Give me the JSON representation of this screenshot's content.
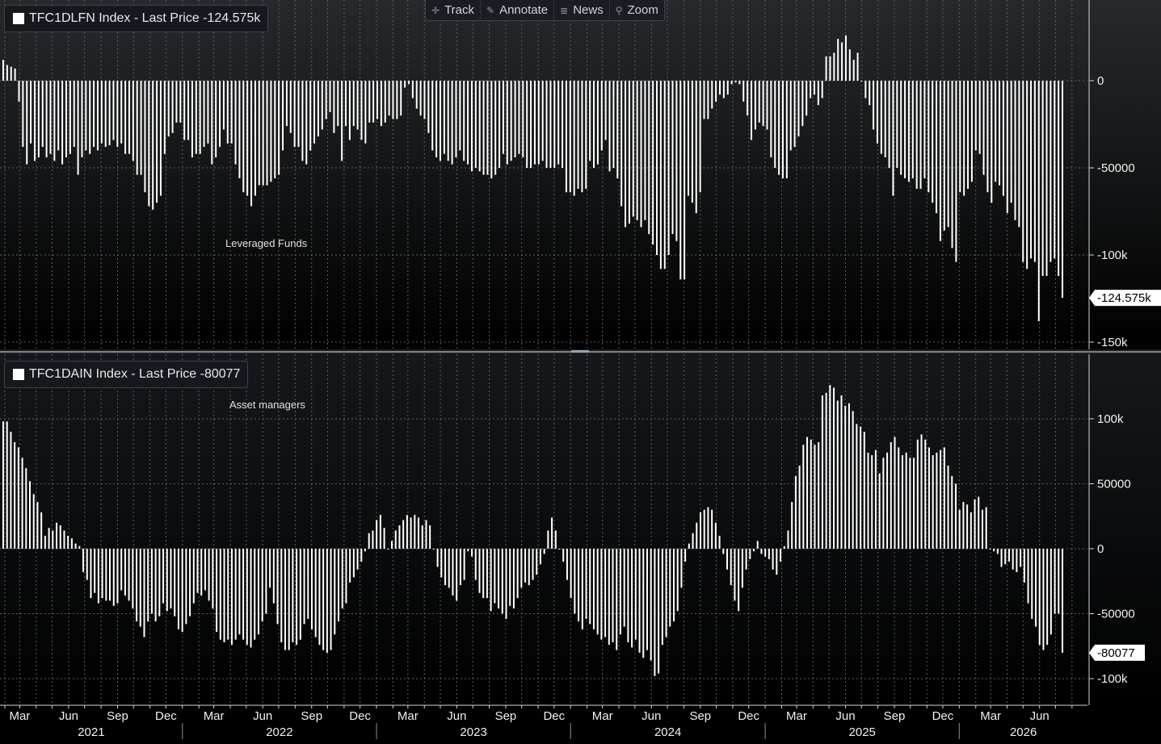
{
  "toolbar": {
    "track": "Track",
    "annotate": "Annotate",
    "news": "News",
    "zoom": "Zoom"
  },
  "panels": {
    "top": {
      "legend": "TFC1DLFN Index - Last Price -124.575k",
      "label": "Leveraged Funds"
    },
    "bottom": {
      "legend": "TFC1DAIN Index - Last Price -80077",
      "label": "Asset managers"
    }
  },
  "colors": {
    "background_top": "#202326",
    "background_bottom": "#000000",
    "bars": "#ffffff",
    "grid": "#5a5f66"
  },
  "chart_data": [
    {
      "type": "bar",
      "title": "",
      "series_label": "Leveraged Funds",
      "last_price_label": "-124.575k",
      "last_price": -124575,
      "ylim": [
        -150000,
        30000
      ],
      "y_ticks": [
        0,
        -50000,
        -100000,
        -150000
      ],
      "y_tick_labels": [
        "0",
        "-50000",
        "-100k",
        "-150k"
      ],
      "grid": true,
      "x_start": "2021-01-29",
      "x_end": "2026-07-14",
      "values": [
        12000,
        9000,
        8000,
        7000,
        -12000,
        -38000,
        -48000,
        -36000,
        -46000,
        -44000,
        -38000,
        -44000,
        -42000,
        -46000,
        -40000,
        -48000,
        -44000,
        -42000,
        -38000,
        -54000,
        -44000,
        -40000,
        -42000,
        -38000,
        -40000,
        -36000,
        -38000,
        -37000,
        -34000,
        -38000,
        -36000,
        -42000,
        -42000,
        -46000,
        -54000,
        -54000,
        -64000,
        -72000,
        -74000,
        -70000,
        -66000,
        -42000,
        -32000,
        -30000,
        -24000,
        -24000,
        -34000,
        -34000,
        -44000,
        -42000,
        -42000,
        -38000,
        -36000,
        -48000,
        -44000,
        -38000,
        -28000,
        -36000,
        -36000,
        -48000,
        -56000,
        -64000,
        -66000,
        -72000,
        -66000,
        -60000,
        -60000,
        -60000,
        -58000,
        -56000,
        -54000,
        -40000,
        -26000,
        -30000,
        -38000,
        -38000,
        -46000,
        -48000,
        -40000,
        -36000,
        -32000,
        -28000,
        -22000,
        -18000,
        -30000,
        -26000,
        -46000,
        -26000,
        -34000,
        -26000,
        -28000,
        -34000,
        -36000,
        -24000,
        -24000,
        -22000,
        -26000,
        -24000,
        -20000,
        -22000,
        -22000,
        -20000,
        -4000,
        -2000,
        -10000,
        -16000,
        -20000,
        -22000,
        -30000,
        -40000,
        -44000,
        -46000,
        -42000,
        -46000,
        -48000,
        -44000,
        -40000,
        -46000,
        -48000,
        -52000,
        -50000,
        -52000,
        -54000,
        -54000,
        -56000,
        -54000,
        -50000,
        -42000,
        -48000,
        -46000,
        -44000,
        -42000,
        -44000,
        -50000,
        -50000,
        -48000,
        -48000,
        -46000,
        -50000,
        -50000,
        -50000,
        -48000,
        -50000,
        -64000,
        -64000,
        -66000,
        -62000,
        -64000,
        -62000,
        -46000,
        -50000,
        -48000,
        -40000,
        -34000,
        -52000,
        -50000,
        -56000,
        -72000,
        -84000,
        -82000,
        -78000,
        -80000,
        -84000,
        -80000,
        -88000,
        -94000,
        -100000,
        -108000,
        -108000,
        -100000,
        -88000,
        -92000,
        -114000,
        -114000,
        -66000,
        -70000,
        -76000,
        -64000,
        -22000,
        -22000,
        -16000,
        -12000,
        -8000,
        -10000,
        -8000,
        -2000,
        -1000,
        -2000,
        -12000,
        -20000,
        -34000,
        -28000,
        -24000,
        -26000,
        -28000,
        -44000,
        -50000,
        -54000,
        -56000,
        -56000,
        -40000,
        -38000,
        -32000,
        -26000,
        -20000,
        -10000,
        -8000,
        -14000,
        -10000,
        14000,
        14000,
        16000,
        24000,
        22000,
        26000,
        18000,
        12000,
        16000,
        0,
        -10000,
        -14000,
        -28000,
        -36000,
        -42000,
        -44000,
        -50000,
        -66000,
        -50000,
        -54000,
        -56000,
        -58000,
        -56000,
        -62000,
        -62000,
        -56000,
        -64000,
        -70000,
        -76000,
        -92000,
        -86000,
        -84000,
        -96000,
        -104000,
        -64000,
        -66000,
        -62000,
        -58000,
        -40000,
        -42000,
        -54000,
        -64000,
        -70000,
        -58000,
        -60000,
        -66000,
        -76000,
        -70000,
        -80000,
        -84000,
        -104000,
        -108000,
        -102000,
        -104000,
        -138000,
        -112000,
        -112000,
        -104000,
        -102000,
        -112000,
        -124575
      ]
    },
    {
      "type": "bar",
      "title": "",
      "series_label": "Asset managers",
      "last_price_label": "-80077",
      "last_price": -80077,
      "ylim": [
        -120000,
        150000
      ],
      "y_ticks": [
        100000,
        50000,
        0,
        -50000,
        -100000
      ],
      "y_tick_labels": [
        "100k",
        "50000",
        "0",
        "-50000",
        "-100k"
      ],
      "grid": true,
      "x_start": "2021-01-29",
      "x_end": "2026-07-14",
      "x_tick_labels": [
        "Mar",
        "Jun",
        "Sep",
        "Dec",
        "Mar",
        "Jun",
        "Sep",
        "Dec",
        "Mar",
        "Jun",
        "Sep",
        "Dec",
        "Mar",
        "Jun",
        "Sep",
        "Dec",
        "Mar",
        "Jun",
        "Sep",
        "Dec",
        "Mar",
        "Jun"
      ],
      "year_labels": [
        "2021",
        "2022",
        "2023",
        "2024",
        "2025",
        "2026"
      ],
      "values": [
        98000,
        98000,
        90000,
        82000,
        78000,
        70000,
        62000,
        52000,
        42000,
        36000,
        28000,
        10000,
        16000,
        14000,
        20000,
        18000,
        14000,
        10000,
        8000,
        4000,
        2000,
        -18000,
        -24000,
        -38000,
        -34000,
        -42000,
        -38000,
        -40000,
        -40000,
        -44000,
        -42000,
        -32000,
        -36000,
        -40000,
        -46000,
        -56000,
        -60000,
        -68000,
        -56000,
        -50000,
        -56000,
        -52000,
        -42000,
        -48000,
        -46000,
        -52000,
        -62000,
        -64000,
        -58000,
        -52000,
        -42000,
        -34000,
        -36000,
        -32000,
        -40000,
        -46000,
        -64000,
        -70000,
        -72000,
        -70000,
        -74000,
        -70000,
        -66000,
        -70000,
        -74000,
        -76000,
        -70000,
        -66000,
        -56000,
        -50000,
        -30000,
        -42000,
        -58000,
        -72000,
        -78000,
        -78000,
        -72000,
        -74000,
        -70000,
        -58000,
        -54000,
        -62000,
        -68000,
        -74000,
        -78000,
        -80000,
        -78000,
        -66000,
        -56000,
        -46000,
        -42000,
        -26000,
        -22000,
        -16000,
        -10000,
        -2000,
        12000,
        14000,
        22000,
        26000,
        16000,
        0,
        6000,
        14000,
        18000,
        22000,
        26000,
        24000,
        26000,
        24000,
        18000,
        22000,
        18000,
        0,
        -14000,
        -22000,
        -28000,
        -30000,
        -36000,
        -40000,
        -28000,
        -24000,
        -2000,
        -6000,
        -24000,
        -34000,
        -38000,
        -38000,
        -48000,
        -42000,
        -46000,
        -50000,
        -54000,
        -44000,
        -46000,
        -38000,
        -30000,
        -26000,
        -28000,
        -24000,
        -20000,
        -12000,
        -4000,
        14000,
        24000,
        14000,
        0,
        -10000,
        -24000,
        -38000,
        -50000,
        -56000,
        -62000,
        -54000,
        -58000,
        -62000,
        -66000,
        -70000,
        -68000,
        -74000,
        -72000,
        -78000,
        -66000,
        -60000,
        -72000,
        -76000,
        -70000,
        -80000,
        -84000,
        -78000,
        -86000,
        -98000,
        -96000,
        -74000,
        -68000,
        -60000,
        -56000,
        -48000,
        -30000,
        -10000,
        4000,
        12000,
        20000,
        28000,
        30000,
        32000,
        30000,
        20000,
        10000,
        -4000,
        -16000,
        -28000,
        -40000,
        -48000,
        -30000,
        -16000,
        -8000,
        -2000,
        6000,
        -4000,
        -6000,
        -8000,
        -16000,
        -20000,
        -10000,
        2000,
        14000,
        36000,
        56000,
        64000,
        80000,
        86000,
        84000,
        80000,
        82000,
        118000,
        120000,
        126000,
        124000,
        114000,
        118000,
        110000,
        112000,
        106000,
        96000,
        94000,
        90000,
        74000,
        72000,
        76000,
        58000,
        70000,
        74000,
        82000,
        86000,
        78000,
        72000,
        74000,
        70000,
        70000,
        84000,
        88000,
        84000,
        78000,
        72000,
        74000,
        76000,
        78000,
        64000,
        56000,
        50000,
        30000,
        36000,
        34000,
        28000,
        38000,
        40000,
        30000,
        32000,
        0,
        -2000,
        -4000,
        -14000,
        -12000,
        -10000,
        -16000,
        -18000,
        -14000,
        -26000,
        -42000,
        -54000,
        -60000,
        -74000,
        -78000,
        -74000,
        -66000,
        -50000,
        -50000,
        -80077
      ]
    }
  ]
}
